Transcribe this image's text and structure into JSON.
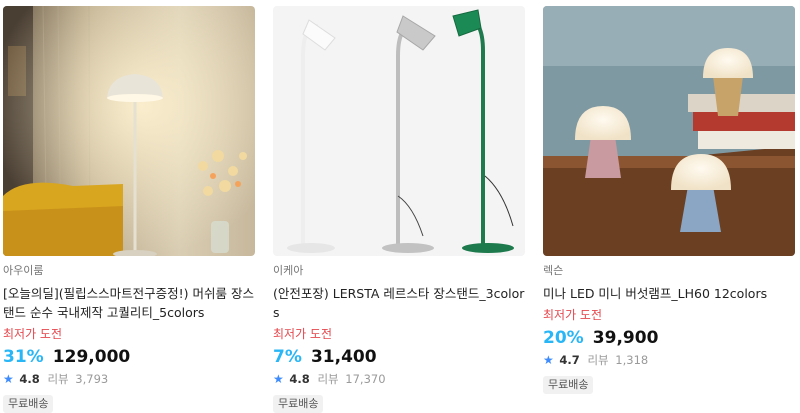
{
  "products": [
    {
      "brand": "아우이룸",
      "title": "[오늘의딜](필립스스마트전구증정!) 머쉬룸 장스탠드 순수 국내제작 고퀄리티_5colors",
      "challenge": "최저가 도전",
      "discount": "31%",
      "price": "129,000",
      "rating": "4.8",
      "review_label": "리뷰",
      "review_count": "3,793",
      "badge": "무료배송",
      "image_icon": "mushroom-floor-lamp-photo"
    },
    {
      "brand": "이케아",
      "title": "(안전포장) LERSTA 레르스타 장스탠드_3colors",
      "challenge": "최저가 도전",
      "discount": "7%",
      "price": "31,400",
      "rating": "4.8",
      "review_label": "리뷰",
      "review_count": "17,370",
      "badge": "무료배송",
      "image_icon": "three-floor-lamps-photo"
    },
    {
      "brand": "렉슨",
      "title": "미나 LED 미니 버섯램프_LH60 12colors",
      "challenge": "최저가 도전",
      "discount": "20%",
      "price": "39,900",
      "rating": "4.7",
      "review_label": "리뷰",
      "review_count": "1,318",
      "badge": "무료배송",
      "image_icon": "mini-mushroom-lamps-photo"
    }
  ],
  "colors": {
    "discount": "#29b6f6",
    "challenge": "#e5484d",
    "star": "#3d8bfd"
  }
}
